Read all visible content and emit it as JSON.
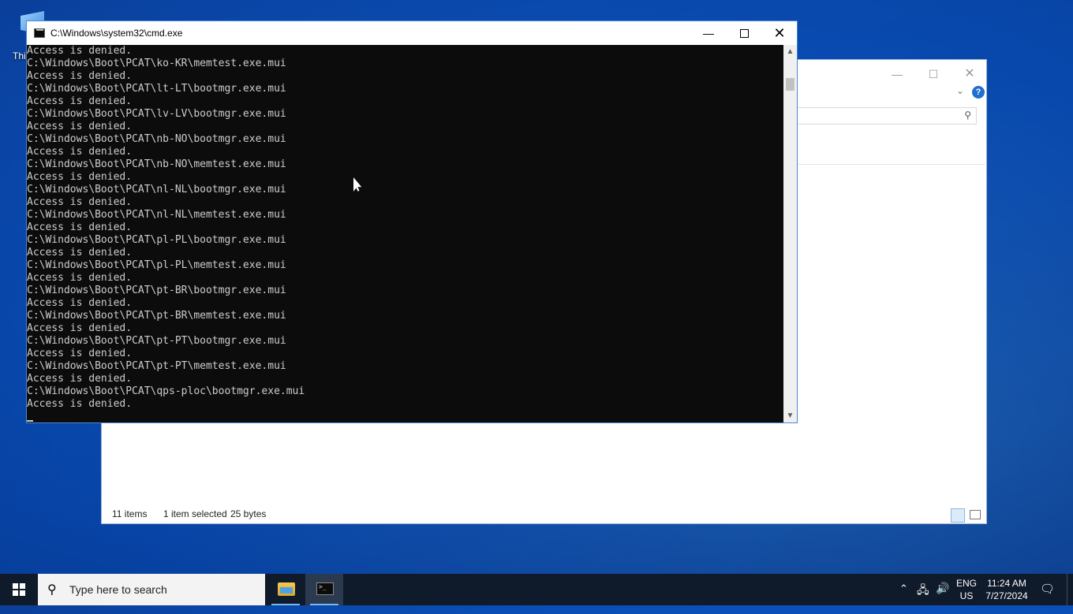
{
  "desktop": {
    "icon_label": "Thi"
  },
  "explorer": {
    "status_items": "11 items",
    "status_selected": "1 item selected",
    "status_size": "25 bytes"
  },
  "cmd": {
    "title": "C:\\Windows\\system32\\cmd.exe",
    "lines": [
      "Access is denied.",
      "C:\\Windows\\Boot\\PCAT\\ko-KR\\memtest.exe.mui",
      "Access is denied.",
      "C:\\Windows\\Boot\\PCAT\\lt-LT\\bootmgr.exe.mui",
      "Access is denied.",
      "C:\\Windows\\Boot\\PCAT\\lv-LV\\bootmgr.exe.mui",
      "Access is denied.",
      "C:\\Windows\\Boot\\PCAT\\nb-NO\\bootmgr.exe.mui",
      "Access is denied.",
      "C:\\Windows\\Boot\\PCAT\\nb-NO\\memtest.exe.mui",
      "Access is denied.",
      "C:\\Windows\\Boot\\PCAT\\nl-NL\\bootmgr.exe.mui",
      "Access is denied.",
      "C:\\Windows\\Boot\\PCAT\\nl-NL\\memtest.exe.mui",
      "Access is denied.",
      "C:\\Windows\\Boot\\PCAT\\pl-PL\\bootmgr.exe.mui",
      "Access is denied.",
      "C:\\Windows\\Boot\\PCAT\\pl-PL\\memtest.exe.mui",
      "Access is denied.",
      "C:\\Windows\\Boot\\PCAT\\pt-BR\\bootmgr.exe.mui",
      "Access is denied.",
      "C:\\Windows\\Boot\\PCAT\\pt-BR\\memtest.exe.mui",
      "Access is denied.",
      "C:\\Windows\\Boot\\PCAT\\pt-PT\\bootmgr.exe.mui",
      "Access is denied.",
      "C:\\Windows\\Boot\\PCAT\\pt-PT\\memtest.exe.mui",
      "Access is denied.",
      "C:\\Windows\\Boot\\PCAT\\qps-ploc\\bootmgr.exe.mui",
      "Access is denied."
    ]
  },
  "taskbar": {
    "search_placeholder": "Type here to search",
    "lang_line1": "ENG",
    "lang_line2": "US",
    "time": "11:24 AM",
    "date": "7/27/2024"
  },
  "colors": {
    "console_bg": "#0c0c0c",
    "console_fg": "#cccccc",
    "taskbar_bg": "#0f1a2a",
    "accent": "#1f6fd1"
  },
  "icons": {
    "start": "windows-logo",
    "search": "magnifier",
    "explorer": "folder",
    "cmd": "console"
  }
}
